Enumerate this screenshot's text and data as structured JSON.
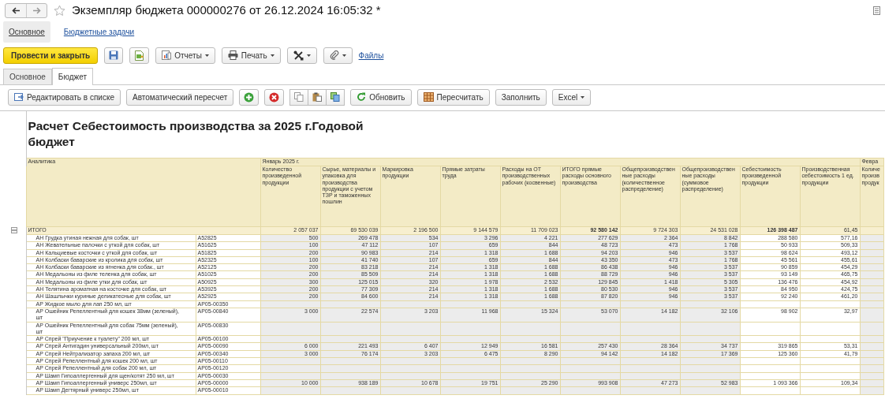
{
  "window": {
    "title": "Экземпляр бюджета 000000276 от 26.12.2024 16:05:32 *"
  },
  "nav_tabs": [
    {
      "label": "Основное",
      "selected": true
    },
    {
      "label": "Бюджетные задачи",
      "selected": false
    }
  ],
  "command_bar": [
    {
      "kind": "primary",
      "label": "Провести и закрыть"
    },
    {
      "kind": "icon"
    },
    {
      "kind": "icon"
    },
    {
      "kind": "dropdown",
      "label": "Отчеты"
    },
    {
      "kind": "dropdown",
      "label": "Печать"
    },
    {
      "kind": "dropdown"
    },
    {
      "kind": "dropdown"
    },
    {
      "kind": "link",
      "label": "Файлы"
    }
  ],
  "form_tabs": [
    {
      "label": "Основное",
      "selected": false
    },
    {
      "label": "Бюджет",
      "selected": true
    }
  ],
  "toolbar": [
    {
      "kind": "button",
      "label": "Редактировать в списке"
    },
    {
      "kind": "button",
      "label": "Автоматический пересчет"
    },
    {
      "kind": "icon"
    },
    {
      "kind": "icon"
    },
    {
      "kind": "grouped"
    },
    {
      "kind": "grouped"
    },
    {
      "kind": "grouped"
    },
    {
      "kind": "button",
      "label": "Обновить"
    },
    {
      "kind": "button",
      "label": "Пересчитать"
    },
    {
      "kind": "button",
      "label": "Заполнить"
    },
    {
      "kind": "dropdown",
      "label": "Excel"
    }
  ],
  "report": {
    "title": "Расчет Себестоимость производства за 2025 г.Годовой бюджет",
    "analytics_heading": "Аналитика",
    "periods": [
      {
        "label": "Январь 2025 г.",
        "columns": [
          {
            "heading": "Количество произведенной продукции",
            "kind": "input"
          },
          {
            "heading": "Сырье, материалы и упаковка для производства продукции с учетом ТЗР и таможенных пошлин",
            "kind": "input"
          },
          {
            "heading": "Маркировка продукции",
            "kind": "input"
          },
          {
            "heading": "Прямые затраты труда",
            "kind": "input"
          },
          {
            "heading": "Расходы на ОТ производственных рабочих (косвенные)",
            "kind": "input"
          },
          {
            "heading": "ИТОГО прямые расходы основного производства",
            "kind": "input"
          },
          {
            "heading": "Общепроизводственные расходы (количественное распределение)",
            "kind": "input"
          },
          {
            "heading": "Общепроизводственные расходы (суммовое распределение)",
            "kind": "input"
          },
          {
            "heading": "Себестоимость произведенной продукции",
            "kind": "result"
          },
          {
            "heading": "Производственная себестоимость 1 ед. продукции",
            "kind": "result"
          }
        ]
      },
      {
        "label": "Февра",
        "columns": [
          {
            "heading": "Количе произв продук",
            "kind": "input"
          }
        ]
      }
    ],
    "total": {
      "name": "ИТОГО",
      "expanded": true,
      "values": [
        {
          "text": "2 057 037",
          "bold": false
        },
        {
          "text": "69 530 039",
          "bold": false
        },
        {
          "text": "2 196 500",
          "bold": false
        },
        {
          "text": "9 144 579",
          "bold": false
        },
        {
          "text": "11 709 023",
          "bold": false
        },
        {
          "text": "92 580 142",
          "bold": true
        },
        {
          "text": "9 724 303",
          "bold": false
        },
        {
          "text": "24 531 028",
          "bold": false
        },
        {
          "text": "126 398 487",
          "bold": true
        },
        {
          "text": "61,45",
          "bold": false
        }
      ],
      "children": [
        {
          "name": "АН Грудка утиная нежная для собак, шт",
          "code": "А52825",
          "values": [
            "500",
            "269 478",
            "534",
            "3 296",
            "4 221",
            "277 629",
            "2 364",
            "8 842",
            "288 580",
            "577,16"
          ]
        },
        {
          "name": "АН Жевательные палочки с уткой для  собак, шт",
          "code": "А51625",
          "values": [
            "100",
            "47 112",
            "107",
            "659",
            "844",
            "48 723",
            "473",
            "1 768",
            "50 933",
            "509,33"
          ]
        },
        {
          "name": "АН Кальциевые косточки с уткой для собак, шт",
          "code": "А51825",
          "values": [
            "200",
            "90 983",
            "214",
            "1 318",
            "1 688",
            "94 203",
            "946",
            "3 537",
            "98 624",
            "493,12"
          ]
        },
        {
          "name": "АН Колбаски баварские из кролика для собак, шт",
          "code": "А52325",
          "values": [
            "100",
            "41 740",
            "107",
            "659",
            "844",
            "43 350",
            "473",
            "1 768",
            "45 561",
            "455,61"
          ]
        },
        {
          "name": "АН Колбаски баварские из ягненка для собак., шт",
          "code": "А52125",
          "values": [
            "200",
            "83 218",
            "214",
            "1 318",
            "1 688",
            "86 438",
            "946",
            "3 537",
            "90 859",
            "454,29"
          ]
        },
        {
          "name": "АН Медальоны из филе теленка для собак, шт",
          "code": "А51025",
          "values": [
            "200",
            "85 509",
            "214",
            "1 318",
            "1 688",
            "88 729",
            "946",
            "3 537",
            "93 149",
            "465,75"
          ]
        },
        {
          "name": "АН Медальоны из филе утки для собак, шт",
          "code": "А50925",
          "values": [
            "300",
            "125 015",
            "320",
            "1 978",
            "2 532",
            "129 845",
            "1 418",
            "5 305",
            "136 476",
            "454,92"
          ]
        },
        {
          "name": "АН Телятина ароматная на косточке для собак, шт",
          "code": "А53925",
          "values": [
            "200",
            "77 309",
            "214",
            "1 318",
            "1 688",
            "80 530",
            "946",
            "3 537",
            "84 950",
            "424,75"
          ]
        },
        {
          "name": "АН Шашлычки куриные деликатесные  для собак, шт",
          "code": "А52925",
          "values": [
            "200",
            "84 600",
            "214",
            "1 318",
            "1 688",
            "87 820",
            "946",
            "3 537",
            "92 240",
            "461,20"
          ]
        },
        {
          "name": "АР Жидкое мыло для лап 250 мл, шт",
          "code": "АР05-00350"
        },
        {
          "name": "АР Ошейник Репеллентный для кошек 38мм (зеленый),\nшт",
          "code": "АР05-00840",
          "values": [
            "3 000",
            "22 574",
            "3 203",
            "11 968",
            "15 324",
            "53 070",
            "14 182",
            "32 106",
            "98 902",
            "32,97"
          ]
        },
        {
          "name": "АР Ошейник Репеллентный для собак 75мм (зеленый),\nшт",
          "code": "АР05-00830"
        },
        {
          "name": "АР Спрей \"Приучение к туалету\" 200 мл, шт",
          "code": "АР05-00100"
        },
        {
          "name": "АР Спрей Антигадин универсальный 200мл, шт",
          "code": "АР05-00090",
          "values": [
            "6 000",
            "221 493",
            "6 407",
            "12 949",
            "16 581",
            "257 430",
            "28 364",
            "34 737",
            "319 865",
            "53,31"
          ]
        },
        {
          "name": "АР Спрей Нейтрализатор запаха  200 мл, шт",
          "code": "АР05-00340",
          "values": [
            "3 000",
            "76 174",
            "3 203",
            "6 475",
            "8 290",
            "94 142",
            "14 182",
            "17 369",
            "125 360",
            "41,79"
          ]
        },
        {
          "name": "АР Спрей Репеллентный для кошек 200 мл, шт",
          "code": "АР05-00110"
        },
        {
          "name": "АР Спрей Репеллентный для собак 200 мл, шт",
          "code": "АР05-00120"
        },
        {
          "name": "АР Шамп Гипоаллергенный для щен/котят 250 мл, шт",
          "code": "АР05-00030"
        },
        {
          "name": "АР Шамп Гипоаллергенный универс 250мл, шт",
          "code": "АР05-00000",
          "values": [
            "10 000",
            "938 189",
            "10 678",
            "19 751",
            "25 290",
            "993 908",
            "47 273",
            "52 983",
            "1 093 366",
            "109,34"
          ]
        },
        {
          "name": "АР Шамп Дегтярный универс 250мл, шт",
          "code": "АР05-00010"
        }
      ]
    }
  }
}
